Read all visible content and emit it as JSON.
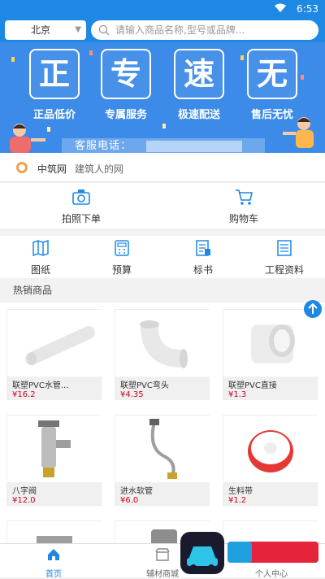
{
  "status": {
    "time": "6:53"
  },
  "search": {
    "city": "北京",
    "placeholder": "请输入商品名称,型号或品牌..."
  },
  "banner": {
    "features": [
      {
        "char": "正",
        "caption": "正品低价"
      },
      {
        "char": "专",
        "caption": "专属服务"
      },
      {
        "char": "速",
        "caption": "极速配送"
      },
      {
        "char": "无",
        "caption": "售后无忧"
      }
    ],
    "hotline_label": "客服电话："
  },
  "site": {
    "name": "中筑网",
    "slogan": "建筑人的网"
  },
  "actions": [
    {
      "label": "拍照下单",
      "icon": "camera-icon"
    },
    {
      "label": "购物车",
      "icon": "cart-icon"
    }
  ],
  "categories": [
    {
      "label": "图纸",
      "icon": "map-icon"
    },
    {
      "label": "预算",
      "icon": "calculator-icon"
    },
    {
      "label": "标书",
      "icon": "bid-document-icon"
    },
    {
      "label": "工程资料",
      "icon": "document-icon"
    }
  ],
  "section": {
    "title": "热销商品"
  },
  "products": [
    {
      "name": "联塑PVC水管...",
      "price": "¥16.2"
    },
    {
      "name": "联塑PVC弯头",
      "price": "¥4.35"
    },
    {
      "name": "联塑PVC直接",
      "price": "¥1.3"
    },
    {
      "name": "八字阀",
      "price": "¥12.0"
    },
    {
      "name": "进水软管",
      "price": "¥6.0"
    },
    {
      "name": "生料带",
      "price": "¥1.2"
    }
  ],
  "tabs": [
    {
      "label": "首页",
      "active": true
    },
    {
      "label": "辅材商城",
      "active": false
    },
    {
      "label": "个人中心",
      "active": false
    }
  ],
  "colors": {
    "primary": "#1e88e5",
    "price": "#d0021b",
    "banner": "#3d8be8"
  }
}
